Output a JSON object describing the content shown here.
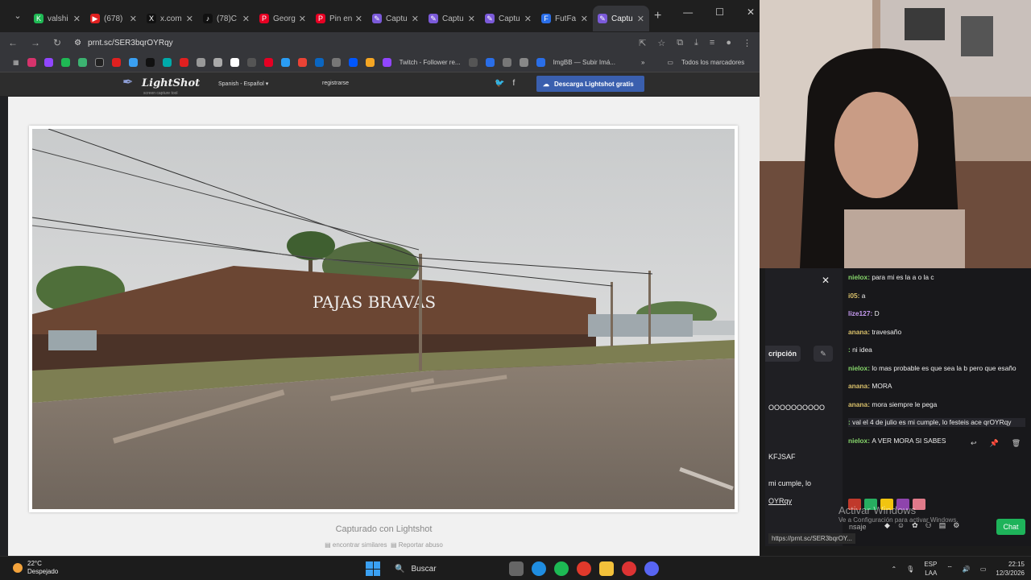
{
  "browser": {
    "tabs": [
      {
        "label": "valshi",
        "color": "#1fb954",
        "glyph": "K"
      },
      {
        "label": "(678)",
        "color": "#e02020",
        "glyph": "▶"
      },
      {
        "label": "x.com",
        "color": "#111111",
        "glyph": "X"
      },
      {
        "label": "(78)C",
        "color": "#111111",
        "glyph": "♪"
      },
      {
        "label": "Georg",
        "color": "#e60023",
        "glyph": "P"
      },
      {
        "label": "Pin en",
        "color": "#e60023",
        "glyph": "P"
      },
      {
        "label": "Captu",
        "color": "#7b5ad9",
        "glyph": "✎"
      },
      {
        "label": "Captu",
        "color": "#7b5ad9",
        "glyph": "✎"
      },
      {
        "label": "Captu",
        "color": "#7b5ad9",
        "glyph": "✎"
      },
      {
        "label": "FutFa",
        "color": "#2a6ee8",
        "glyph": "F"
      },
      {
        "label": "Captu",
        "color": "#7b5ad9",
        "glyph": "✎",
        "active": true
      }
    ],
    "new_tab": "+",
    "url": "prnt.sc/SER3bqrOYRqy",
    "bookmarks": {
      "twitch_follower": "Twitch - Follower re...",
      "imgbb": "ImgBB — Subir Imá...",
      "all_bookmarks": "Todos los marcadores"
    },
    "status_url": "https://prnt.sc/SER3bqrOY..."
  },
  "lightshot": {
    "logo": "LightShot",
    "logo_sub": "screen capture tool",
    "language": "Spanish - Español",
    "register": "registrarse",
    "download_button": "Descarga Lightshot gratis",
    "captured_with": "Capturado con Lightshot",
    "find_similar": "encontrar similares",
    "report_abuse": "Reportar abuso",
    "photo_sign": "PAJAS BRAVAS"
  },
  "chat": {
    "left_button": "cripción",
    "left_fragments": [
      "OOOOOOOOOO",
      "KFJSAF",
      "mi cumple, lo",
      "OYRqy"
    ],
    "messages": [
      {
        "user": "nielox",
        "text": "para mi es la a o la c"
      },
      {
        "user": "i05",
        "text": "a"
      },
      {
        "user": "lize127",
        "text": "D"
      },
      {
        "user": "anana",
        "text": "travesaño"
      },
      {
        "user": "",
        "text": "ni idea"
      },
      {
        "user": "nielox",
        "text": "lo mas probable es que sea la b pero que esaño"
      },
      {
        "user": "anana",
        "text": "MORA"
      },
      {
        "user": "anana",
        "text": "mora siempre le pega"
      },
      {
        "user": "",
        "text": "val el 4 de julio es mi cumple, lo festeis ace qrOYRqy"
      },
      {
        "user": "nielox",
        "text": "A VER MORA SI SABES"
      }
    ],
    "input_placeholder": "nsaje",
    "chat_button": "Chat",
    "watermark_line1": "Activar Windows",
    "watermark_line2": "Ve a Configuración para activar Windows."
  },
  "taskbar": {
    "temperature": "22°C",
    "weather": "Despejado",
    "search": "Buscar",
    "lang1": "ESP",
    "lang2": "LAA",
    "time": "22:15",
    "date": "12/3/2026"
  }
}
